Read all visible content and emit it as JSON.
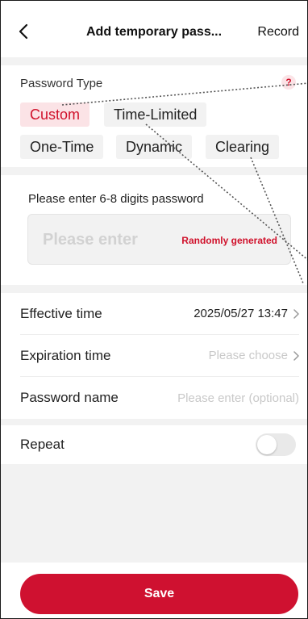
{
  "header": {
    "title": "Add temporary pass...",
    "record_label": "Record"
  },
  "password_type": {
    "label": "Password Type",
    "help": "?",
    "options": [
      "Custom",
      "Time-Limited",
      "One-Time",
      "Dynamic",
      "Clearing"
    ],
    "selected": "Custom"
  },
  "password_input": {
    "label": "Please enter 6-8 digits password",
    "placeholder": "Please enter",
    "random_label": "Randomly generated"
  },
  "settings": {
    "effective_label": "Effective time",
    "effective_value": "2025/05/27 13:47",
    "expiration_label": "Expiration time",
    "expiration_value": "Please choose",
    "name_label": "Password name",
    "name_placeholder": "Please enter (optional)"
  },
  "repeat": {
    "label": "Repeat",
    "enabled": false
  },
  "footer": {
    "save_label": "Save"
  },
  "colors": {
    "accent": "#cf1130",
    "chip_active_bg": "#fbe3e6",
    "page_bg": "#f2f2f2"
  },
  "icons": [
    "back-chevron-icon",
    "help-icon",
    "chevron-right-icon"
  ]
}
